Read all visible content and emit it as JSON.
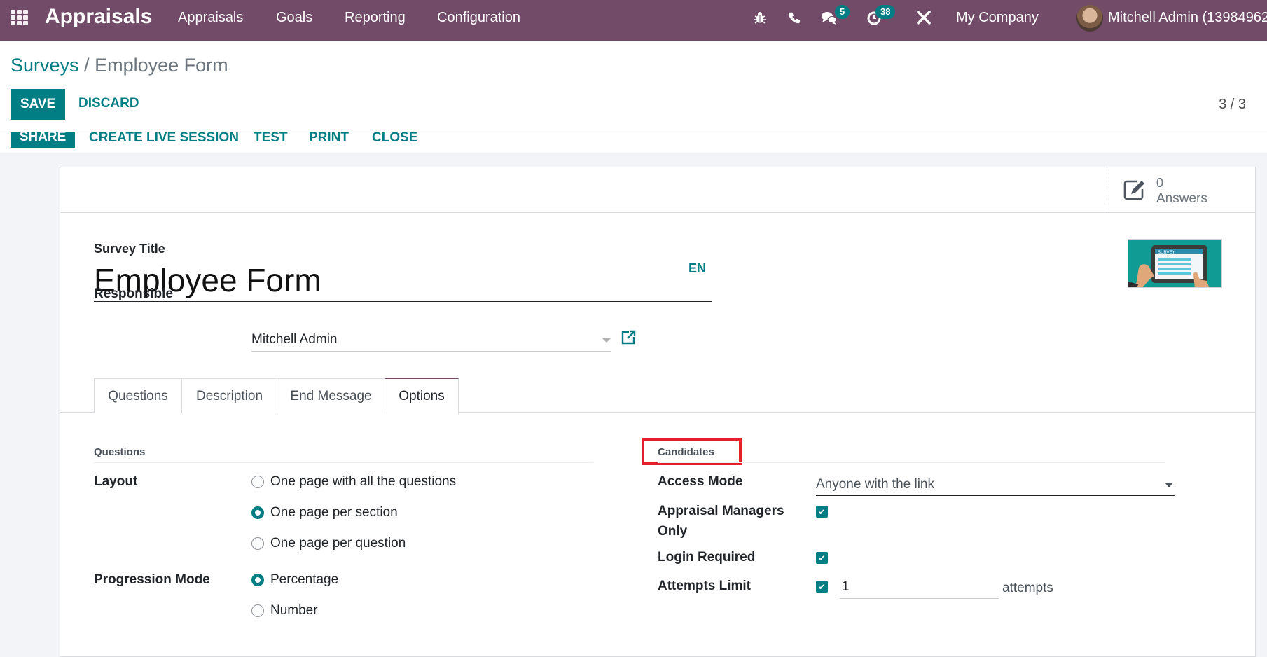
{
  "navbar": {
    "app_name": "Appraisals",
    "menu": [
      "Appraisals",
      "Goals",
      "Reporting",
      "Configuration"
    ],
    "icons": [
      "apps-grid-icon",
      "bug-icon",
      "phone-icon",
      "chat-icon",
      "activity-clock-icon",
      "tools-icon"
    ],
    "messages_badge": "5",
    "activities_badge": "38",
    "company": "My Company",
    "user": "Mitchell Admin (13984962"
  },
  "breadcrumb": {
    "parent": "Surveys",
    "separator": " / ",
    "current": "Employee Form"
  },
  "toolbar": {
    "save_label": "SAVE",
    "discard_label": "DISCARD",
    "pager": "3 / 3"
  },
  "statusbar": {
    "buttons": [
      "SHARE",
      "CREATE LIVE SESSION",
      "TEST",
      "PRINT",
      "CLOSE"
    ]
  },
  "stat_button": {
    "value": "0",
    "label": "Answers"
  },
  "form": {
    "title_label": "Survey Title",
    "title_value": "Employee Form",
    "lang": "EN",
    "cover_image_text": "SURVEY",
    "responsible_label": "Responsible",
    "responsible_value": "Mitchell Admin"
  },
  "tabs": [
    {
      "label": "Questions",
      "active": false
    },
    {
      "label": "Description",
      "active": false
    },
    {
      "label": "End Message",
      "active": false
    },
    {
      "label": "Options",
      "active": true
    }
  ],
  "options": {
    "questions_section": "Questions",
    "layout_label": "Layout",
    "layout_options": [
      {
        "label": "One page with all the questions",
        "selected": false
      },
      {
        "label": "One page per section",
        "selected": true
      },
      {
        "label": "One page per question",
        "selected": false
      }
    ],
    "progression_label": "Progression Mode",
    "progression_options": [
      {
        "label": "Percentage",
        "selected": true
      },
      {
        "label": "Number",
        "selected": false
      }
    ],
    "candidates_section": "Candidates",
    "access_mode_label": "Access Mode",
    "access_mode_value": "Anyone with the link",
    "appraisal_managers_label_1": "Appraisal Managers",
    "appraisal_managers_label_2": "Only",
    "appraisal_managers_checked": true,
    "login_required_label": "Login Required",
    "login_required_checked": true,
    "attempts_limit_label": "Attempts Limit",
    "attempts_limit_checked": true,
    "attempts_value": "1",
    "attempts_unit": "attempts",
    "checkmark": "✔"
  },
  "colors": {
    "navbar": "#714b67",
    "primary": "#017e84",
    "highlight": "#e41e2b"
  }
}
